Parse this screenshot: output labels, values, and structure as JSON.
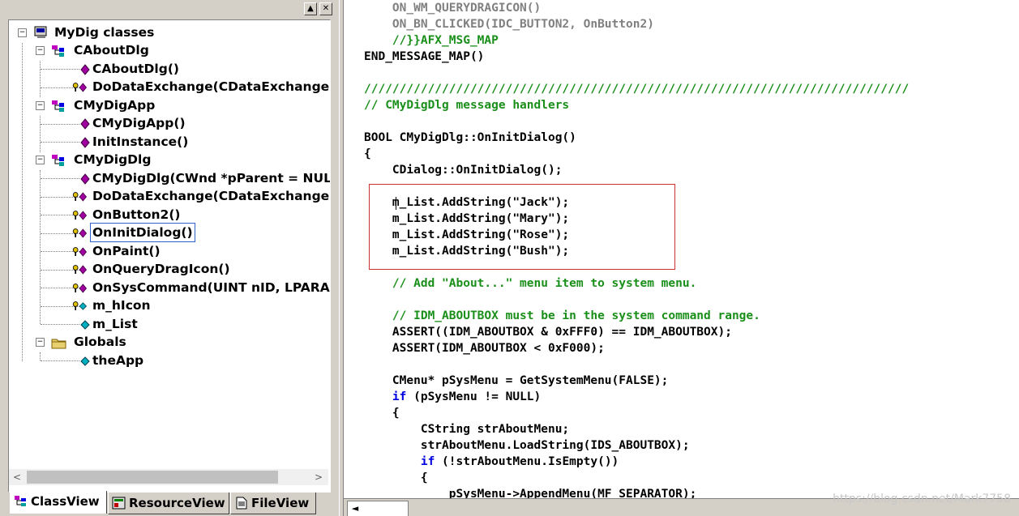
{
  "pane_titlebar": {
    "min_glyph": "▲",
    "close_glyph": "✕"
  },
  "tree": {
    "root": "MyDig classes",
    "classes": [
      {
        "name": "CAboutDlg",
        "members": [
          {
            "label": "CAboutDlg()",
            "icon": "public-method-icon"
          },
          {
            "label": "DoDataExchange(CDataExchange *",
            "icon": "protected-method-icon"
          }
        ]
      },
      {
        "name": "CMyDigApp",
        "members": [
          {
            "label": "CMyDigApp()",
            "icon": "public-method-icon"
          },
          {
            "label": "InitInstance()",
            "icon": "public-method-icon"
          }
        ]
      },
      {
        "name": "CMyDigDlg",
        "members": [
          {
            "label": "CMyDigDlg(CWnd *pParent = NULL)",
            "icon": "public-method-icon"
          },
          {
            "label": "DoDataExchange(CDataExchange *",
            "icon": "protected-method-icon"
          },
          {
            "label": "OnButton2()",
            "icon": "protected-method-icon"
          },
          {
            "label": "OnInitDialog()",
            "icon": "protected-method-icon"
          },
          {
            "label": "OnPaint()",
            "icon": "protected-method-icon"
          },
          {
            "label": "OnQueryDragIcon()",
            "icon": "protected-method-icon"
          },
          {
            "label": "OnSysCommand(UINT nID, LPARAM",
            "icon": "protected-method-icon"
          },
          {
            "label": "m_hIcon",
            "icon": "protected-member-icon"
          },
          {
            "label": "m_List",
            "icon": "public-member-icon"
          }
        ]
      }
    ],
    "globals": {
      "name": "Globals",
      "members": [
        {
          "label": "theApp",
          "icon": "public-member-icon"
        }
      ]
    },
    "selected": "OnInitDialog()"
  },
  "tabs": [
    {
      "label": "ClassView",
      "active": true
    },
    {
      "label": "ResourceView",
      "active": false
    },
    {
      "label": "FileView",
      "active": false
    }
  ],
  "code_lines": [
    "    ON_WM_QUERYDRAGICON()",
    "    ON_BN_CLICKED(IDC_BUTTON2, OnButton2)",
    "    //}}AFX_MSG_MAP",
    "END_MESSAGE_MAP()",
    "",
    "/////////////////////////////////////////////////////////////////////////////",
    "// CMyDigDlg message handlers",
    "",
    "BOOL CMyDigDlg::OnInitDialog()",
    "{",
    "    CDialog::OnInitDialog();",
    "",
    "    m_List.AddString(\"Jack\");",
    "    m_List.AddString(\"Mary\");",
    "    m_List.AddString(\"Rose\");",
    "    m_List.AddString(\"Bush\");",
    "",
    "    // Add \"About...\" menu item to system menu.",
    "",
    "    // IDM_ABOUTBOX must be in the system command range.",
    "    ASSERT((IDM_ABOUTBOX & 0xFFF0) == IDM_ABOUTBOX);",
    "    ASSERT(IDM_ABOUTBOX < 0xF000);",
    "",
    "    CMenu* pSysMenu = GetSystemMenu(FALSE);",
    "    if (pSysMenu != NULL)",
    "    {",
    "        CString strAboutMenu;",
    "        strAboutMenu.LoadString(IDS_ABOUTBOX);",
    "        if (!strAboutMenu.IsEmpty())",
    "        {",
    "            pSysMenu->AppendMenu(MF_SEPARATOR);"
  ],
  "code_styles": [
    "grey",
    "grey",
    "comment",
    "plain",
    "plain",
    "comment",
    "comment",
    "plain",
    "plain",
    "plain",
    "plain",
    "plain",
    "plain",
    "plain",
    "plain",
    "plain",
    "plain",
    "comment",
    "plain",
    "comment",
    "plain",
    "plain",
    "plain",
    "plain",
    "kw-if",
    "plain",
    "plain",
    "plain",
    "kw-if",
    "plain",
    "plain"
  ],
  "scroll_arrows": {
    "left": "<",
    "right": ">",
    "bottom_left": "◄"
  },
  "watermark": "https://blog.csdn.net/Mark7758",
  "colors": {
    "comment": "#1a8f1a",
    "keyword": "#0000e0",
    "highlight_box": "#c83232",
    "selection": "#3060c8"
  }
}
